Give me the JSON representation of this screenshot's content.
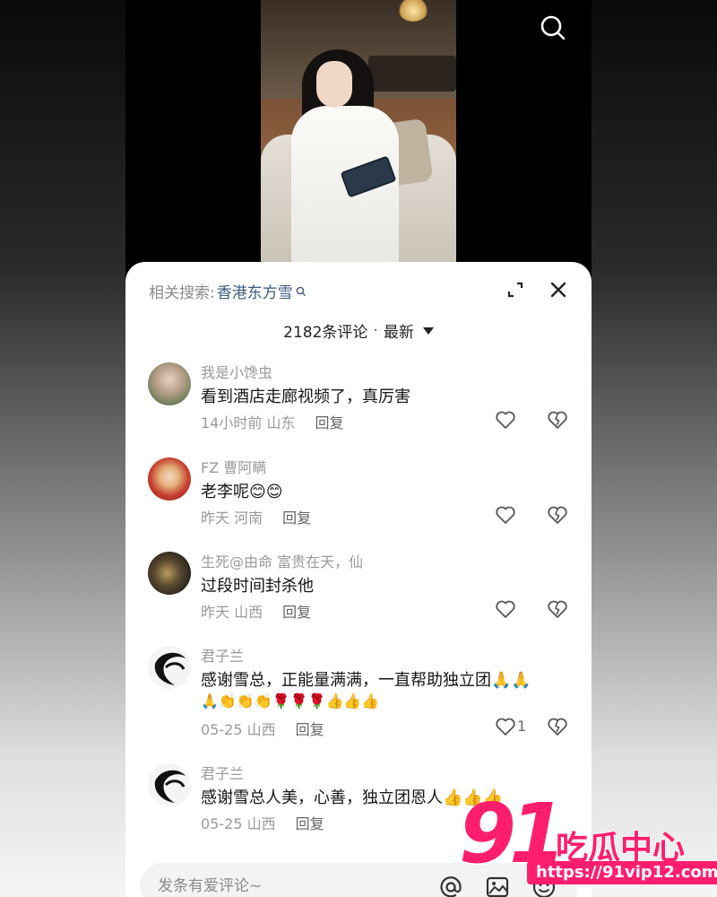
{
  "topbar": {
    "search_icon": "search-icon"
  },
  "sheet": {
    "related_search": {
      "label": "相关搜索:",
      "keyword": "香港东方雪"
    },
    "expand_icon": "expand-icon",
    "close_icon": "close-icon",
    "comment_count": "2182条评论",
    "separator": "·",
    "sort": "最新"
  },
  "comments": [
    {
      "user": "我是小馋虫",
      "text": "看到酒店走廊视频了，真厉害",
      "extra_line": "",
      "time": "14小时前",
      "location": "山东",
      "reply": "回复",
      "likes": ""
    },
    {
      "user": "FZ 曹阿瞒",
      "text": "老李呢😊😊",
      "extra_line": "",
      "time": "昨天",
      "location": "河南",
      "reply": "回复",
      "likes": ""
    },
    {
      "user": "生死@由命 富贵在天，仙",
      "text": "过段时间封杀他",
      "extra_line": "",
      "time": "昨天",
      "location": "山西",
      "reply": "回复",
      "likes": ""
    },
    {
      "user": "君子兰",
      "text": "感谢雪总，正能量满满，一直帮助独立团🙏🙏",
      "extra_line": "🙏👏👏👏🌹🌹🌹👍👍👍",
      "time": "05-25",
      "location": "山西",
      "reply": "回复",
      "likes": "1"
    },
    {
      "user": "君子兰",
      "text": "感谢雪总人美，心善，独立团恩人👍👍👍",
      "extra_line": "",
      "time": "05-25",
      "location": "山西",
      "reply": "回复",
      "likes": ""
    }
  ],
  "input": {
    "placeholder": "发条有爱评论~"
  },
  "watermark": {
    "number": "91",
    "name": "吃瓜中心",
    "url": "https://91vip12.com"
  }
}
